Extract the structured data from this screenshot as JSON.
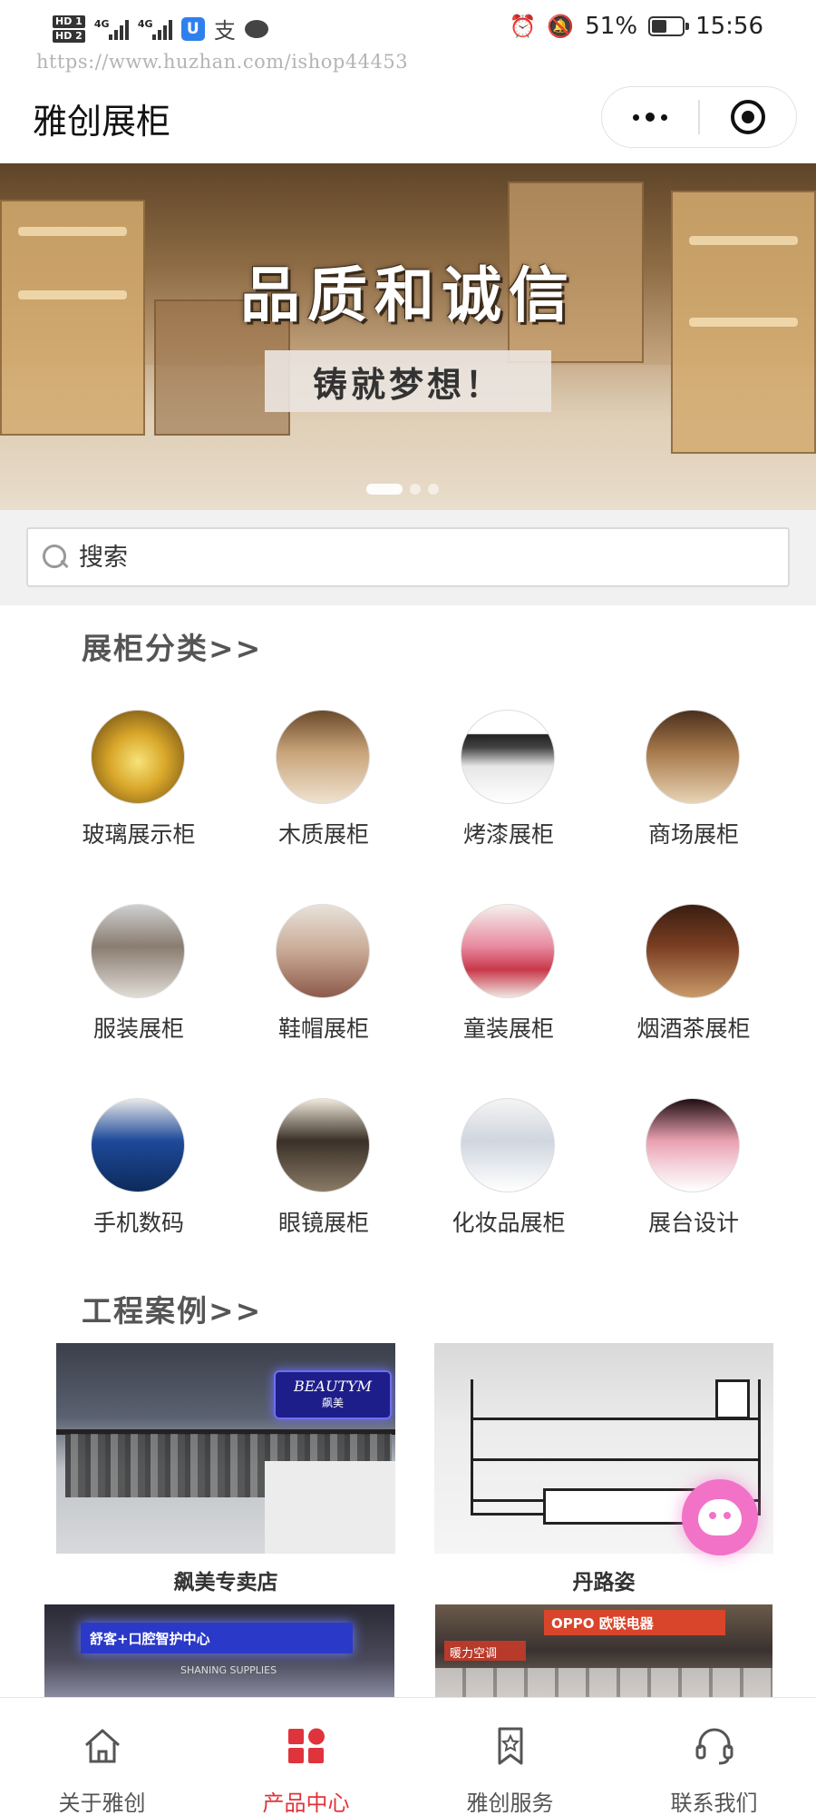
{
  "status_bar": {
    "hd_top": "HD 1",
    "hd_bottom": "HD 2",
    "signal1": "4G",
    "signal2": "4G",
    "app_badge": "U",
    "zhi": "支",
    "battery": "51%",
    "battery_level": 0.51,
    "time": "15:56"
  },
  "watermark": "https://www.huzhan.com/ishop44453",
  "header": {
    "title": "雅创展柜"
  },
  "banner": {
    "headline": "品质和诚信",
    "subline": "铸就梦想！",
    "slide_count": 3,
    "active_slide": 1
  },
  "search": {
    "placeholder": "搜索"
  },
  "categories": {
    "heading": "展柜分类>>",
    "items": [
      {
        "label": "玻璃展示柜"
      },
      {
        "label": "木质展柜"
      },
      {
        "label": "烤漆展柜"
      },
      {
        "label": "商场展柜"
      },
      {
        "label": "服装展柜"
      },
      {
        "label": "鞋帽展柜"
      },
      {
        "label": "童装展柜"
      },
      {
        "label": "烟酒茶展柜"
      },
      {
        "label": "手机数码"
      },
      {
        "label": "眼镜展柜"
      },
      {
        "label": "化妆品展柜"
      },
      {
        "label": "展台设计"
      }
    ]
  },
  "cases": {
    "heading": "工程案例>>",
    "items": [
      {
        "title": "飙美专卖店",
        "sign": "BEAUTYM",
        "sign_sub": "飙美"
      },
      {
        "title": "丹路姿",
        "sign": ""
      },
      {
        "title": "",
        "sign": "舒客+口腔智护中心",
        "sign_sub": "SHANING SUPPLIES"
      },
      {
        "title": "",
        "sign": "OPPO 欧联电器",
        "sign_sub": "暖力空调"
      }
    ]
  },
  "tabbar": {
    "items": [
      {
        "label": "关于雅创",
        "icon": "home-icon"
      },
      {
        "label": "产品中心",
        "icon": "grid-icon"
      },
      {
        "label": "雅创服务",
        "icon": "bookmark-star-icon"
      },
      {
        "label": "联系我们",
        "icon": "headset-icon"
      }
    ],
    "active_index": 1
  },
  "colors": {
    "accent": "#e0343c",
    "float_chat": "#f272c8",
    "search_bg": "#f1f1f1"
  }
}
